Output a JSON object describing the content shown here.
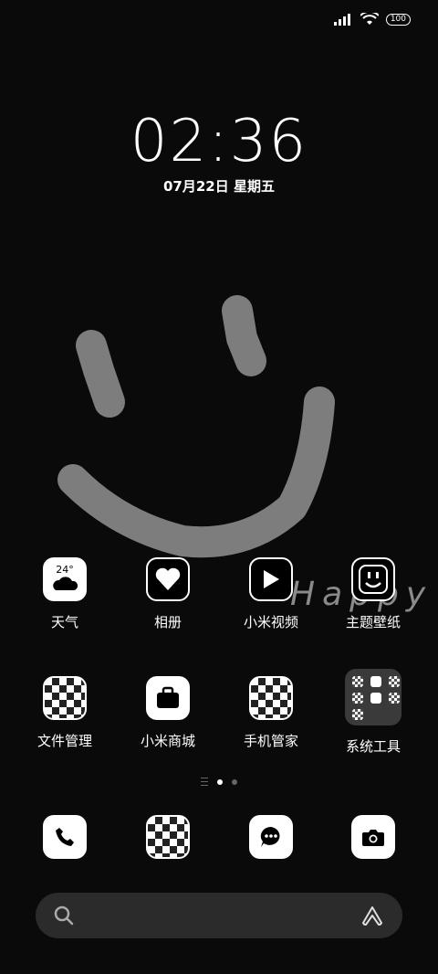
{
  "status_bar": {
    "battery": "100",
    "icons": [
      "signal-icon",
      "wifi-icon",
      "battery-icon"
    ]
  },
  "clock": {
    "time": "02:36",
    "date": "07月22日 星期五"
  },
  "wallpaper": {
    "text": "Happy"
  },
  "apps_row1": [
    {
      "label": "天气",
      "icon": "weather-icon",
      "temp": "24°"
    },
    {
      "label": "相册",
      "icon": "gallery-icon"
    },
    {
      "label": "小米视频",
      "icon": "video-icon"
    },
    {
      "label": "主题壁纸",
      "icon": "themes-icon"
    }
  ],
  "apps_row2": [
    {
      "label": "文件管理",
      "icon": "file-manager-icon"
    },
    {
      "label": "小米商城",
      "icon": "store-icon"
    },
    {
      "label": "手机管家",
      "icon": "security-icon"
    },
    {
      "label": "系统工具",
      "icon": "tools-folder-icon"
    }
  ],
  "dock": [
    "phone-icon",
    "browser-icon",
    "messages-icon",
    "camera-icon"
  ],
  "page_indicator": {
    "pages": 2,
    "active": 1
  },
  "search_bar": {
    "left_icon": "search-icon",
    "right_icon": "assistant-icon"
  }
}
